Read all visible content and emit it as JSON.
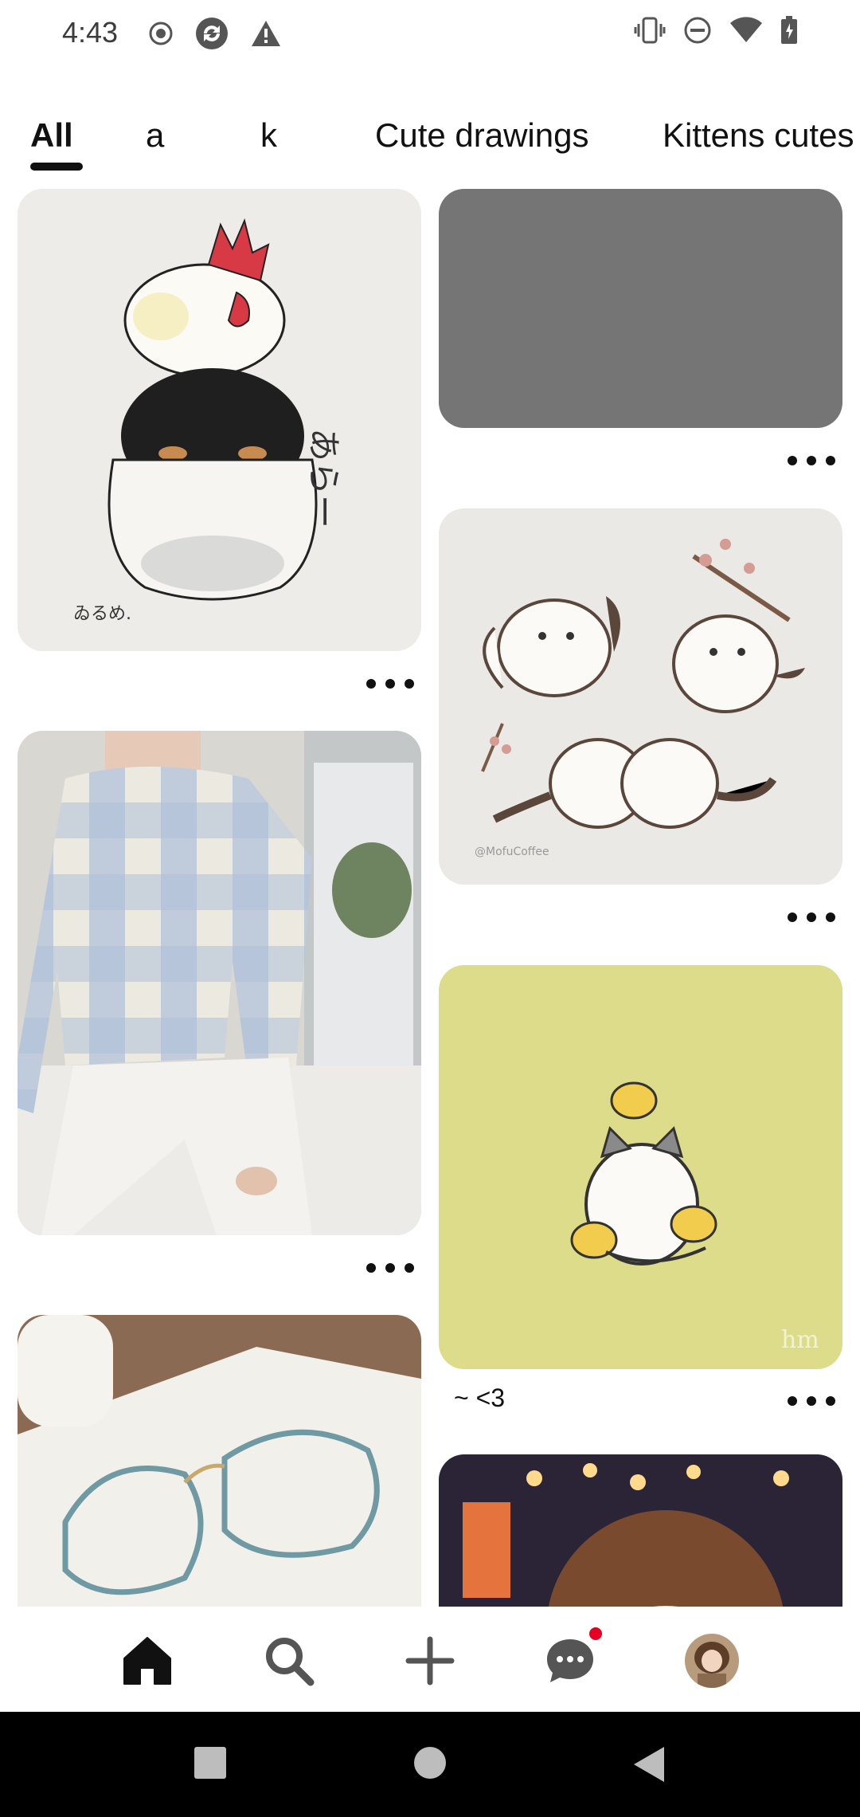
{
  "status_bar": {
    "time": "4:43"
  },
  "tabs": [
    {
      "label": "All",
      "active": true
    },
    {
      "label": "a",
      "active": false
    },
    {
      "label": "k",
      "active": false
    },
    {
      "label": "Cute drawings",
      "active": false
    },
    {
      "label": "Kittens cutes",
      "active": false
    }
  ],
  "pins": [
    {
      "id": "penguin-chicken-drawing",
      "icon": "more-options-icon"
    },
    {
      "id": "gray-placeholder",
      "icon": "more-options-icon"
    },
    {
      "id": "white-birds-drawing",
      "icon": "more-options-icon"
    },
    {
      "id": "plaid-sweater-photo",
      "icon": "more-options-icon"
    },
    {
      "id": "cat-chicks-drawing",
      "caption": "~ <3",
      "icon": "more-options-icon"
    },
    {
      "id": "glasses-photo"
    },
    {
      "id": "anime-girl-illustration"
    }
  ],
  "bottom_nav": {
    "items": [
      "home-icon",
      "search-icon",
      "create-icon",
      "messages-icon",
      "profile-avatar"
    ],
    "active": "home-icon",
    "notification_dot_color": "#e60023"
  },
  "colors": {
    "background": "#ffffff",
    "text": "#111111",
    "placeholder_gray": "#757575",
    "accent_red": "#e60023"
  }
}
